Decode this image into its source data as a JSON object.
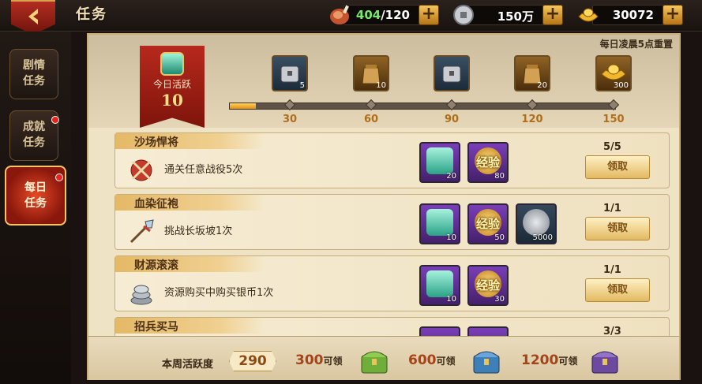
{
  "header": {
    "title": "任务",
    "resources": [
      {
        "name": "stamina",
        "current": "404",
        "max": "/120",
        "icon": "meat-icon"
      },
      {
        "name": "silver",
        "value": "150万",
        "icon": "silver-coin-icon"
      },
      {
        "name": "gold",
        "value": "30072",
        "icon": "gold-ingot-icon"
      }
    ]
  },
  "sidebar": {
    "tabs": [
      {
        "label_line1": "剧情",
        "label_line2": "任务",
        "active": false,
        "badge": false
      },
      {
        "label_line1": "成就",
        "label_line2": "任务",
        "active": false,
        "badge": true
      },
      {
        "label_line1": "每日",
        "label_line2": "任务",
        "active": true,
        "badge": true
      }
    ]
  },
  "activity": {
    "reset_notice": "每日凌晨5点重置",
    "today_label": "今日活跃",
    "today_value": "10",
    "progress_fraction": 0.0667,
    "milestones": [
      {
        "threshold": "30",
        "reward_count": "5",
        "icon": "silver-chest-icon"
      },
      {
        "threshold": "60",
        "reward_count": "10",
        "icon": "bronze-bag-icon"
      },
      {
        "threshold": "90",
        "reward_count": "",
        "icon": "silver-chest-icon"
      },
      {
        "threshold": "120",
        "reward_count": "20",
        "icon": "bronze-bag-icon"
      },
      {
        "threshold": "150",
        "reward_count": "300",
        "icon": "gold-ingot-icon"
      }
    ]
  },
  "tasks": [
    {
      "name": "沙场悍将",
      "desc": "通关任意战役5次",
      "progress": "5/5",
      "button": "领取",
      "icon": "crossed-blades-icon",
      "rewards": [
        {
          "type": "gem",
          "count": "20"
        },
        {
          "type": "xp",
          "label": "经验",
          "count": "80"
        }
      ]
    },
    {
      "name": "血染征袍",
      "desc": "挑战长坂坡1次",
      "progress": "1/1",
      "button": "领取",
      "icon": "spear-icon",
      "rewards": [
        {
          "type": "gem",
          "count": "10"
        },
        {
          "type": "xp",
          "label": "经验",
          "count": "50"
        },
        {
          "type": "coin",
          "count": "5000"
        }
      ]
    },
    {
      "name": "财源滚滚",
      "desc": "资源购买中购买银币1次",
      "progress": "1/1",
      "button": "领取",
      "icon": "coin-stack-icon",
      "rewards": [
        {
          "type": "gem",
          "count": "10"
        },
        {
          "type": "xp",
          "label": "经验",
          "count": "30"
        }
      ]
    },
    {
      "name": "招兵买马",
      "desc": "",
      "progress": "3/3",
      "button": "",
      "icon": "",
      "rewards": []
    }
  ],
  "weekly": {
    "label": "本周活跃度",
    "value": "290",
    "tiers": [
      {
        "amount": "300",
        "suffix": "可领",
        "icon": "green-chest-icon"
      },
      {
        "amount": "600",
        "suffix": "可领",
        "icon": "blue-chest-icon"
      },
      {
        "amount": "1200",
        "suffix": "可领",
        "icon": "purple-chest-icon"
      }
    ]
  }
}
